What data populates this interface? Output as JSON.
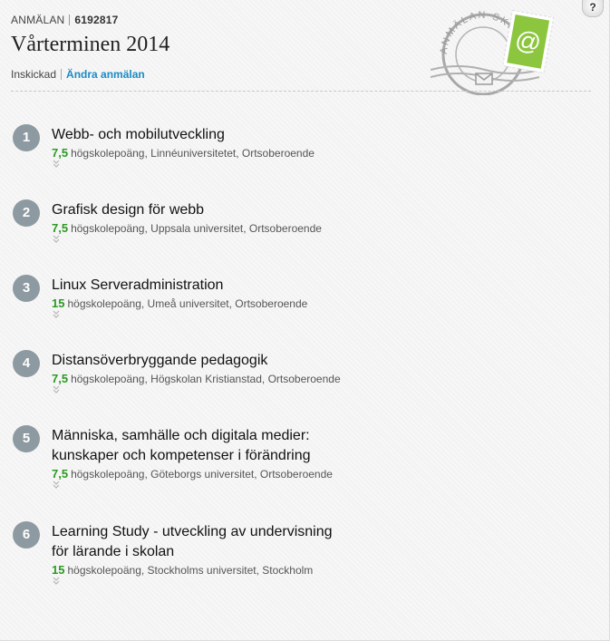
{
  "header": {
    "kicker": "ANMÄLAN",
    "application_number": "6192817",
    "title": "Vårterminen 2014",
    "status": "Inskickad",
    "edit_link": "Ändra anmälan"
  },
  "stamp": {
    "ring_text": "ANMÄLAN SKICKAD",
    "symbol": "@",
    "icon": "envelope-icon",
    "color": "#8cc63f"
  },
  "help": {
    "label": "?"
  },
  "courses": [
    {
      "number": "1",
      "title_lines": [
        "Webb- och mobilutveckling"
      ],
      "credits": "7,5",
      "unit": "högskolepoäng",
      "university": "Linnéuniversitetet",
      "location": "Ortsoberoende"
    },
    {
      "number": "2",
      "title_lines": [
        "Grafisk design för webb"
      ],
      "credits": "7,5",
      "unit": "högskolepoäng",
      "university": "Uppsala universitet",
      "location": "Ortsoberoende"
    },
    {
      "number": "3",
      "title_lines": [
        "Linux Serveradministration"
      ],
      "credits": "15",
      "unit": "högskolepoäng",
      "university": "Umeå universitet",
      "location": "Ortsoberoende"
    },
    {
      "number": "4",
      "title_lines": [
        "Distansöverbryggande pedagogik"
      ],
      "credits": "7,5",
      "unit": "högskolepoäng",
      "university": "Högskolan Kristianstad",
      "location": "Ortsoberoende"
    },
    {
      "number": "5",
      "title_lines": [
        "Människa, samhälle och digitala medier:",
        "kunskaper och kompetenser i förändring"
      ],
      "credits": "7,5",
      "unit": "högskolepoäng",
      "university": "Göteborgs universitet",
      "location": "Ortsoberoende"
    },
    {
      "number": "6",
      "title_lines": [
        "Learning Study - utveckling av undervisning",
        "för lärande i skolan"
      ],
      "credits": "15",
      "unit": "högskolepoäng",
      "university": "Stockholms universitet",
      "location": "Stockholm"
    }
  ],
  "colors": {
    "link": "#1a8bc4",
    "credits": "#2c9a21",
    "badge": "#8e9aa1"
  }
}
